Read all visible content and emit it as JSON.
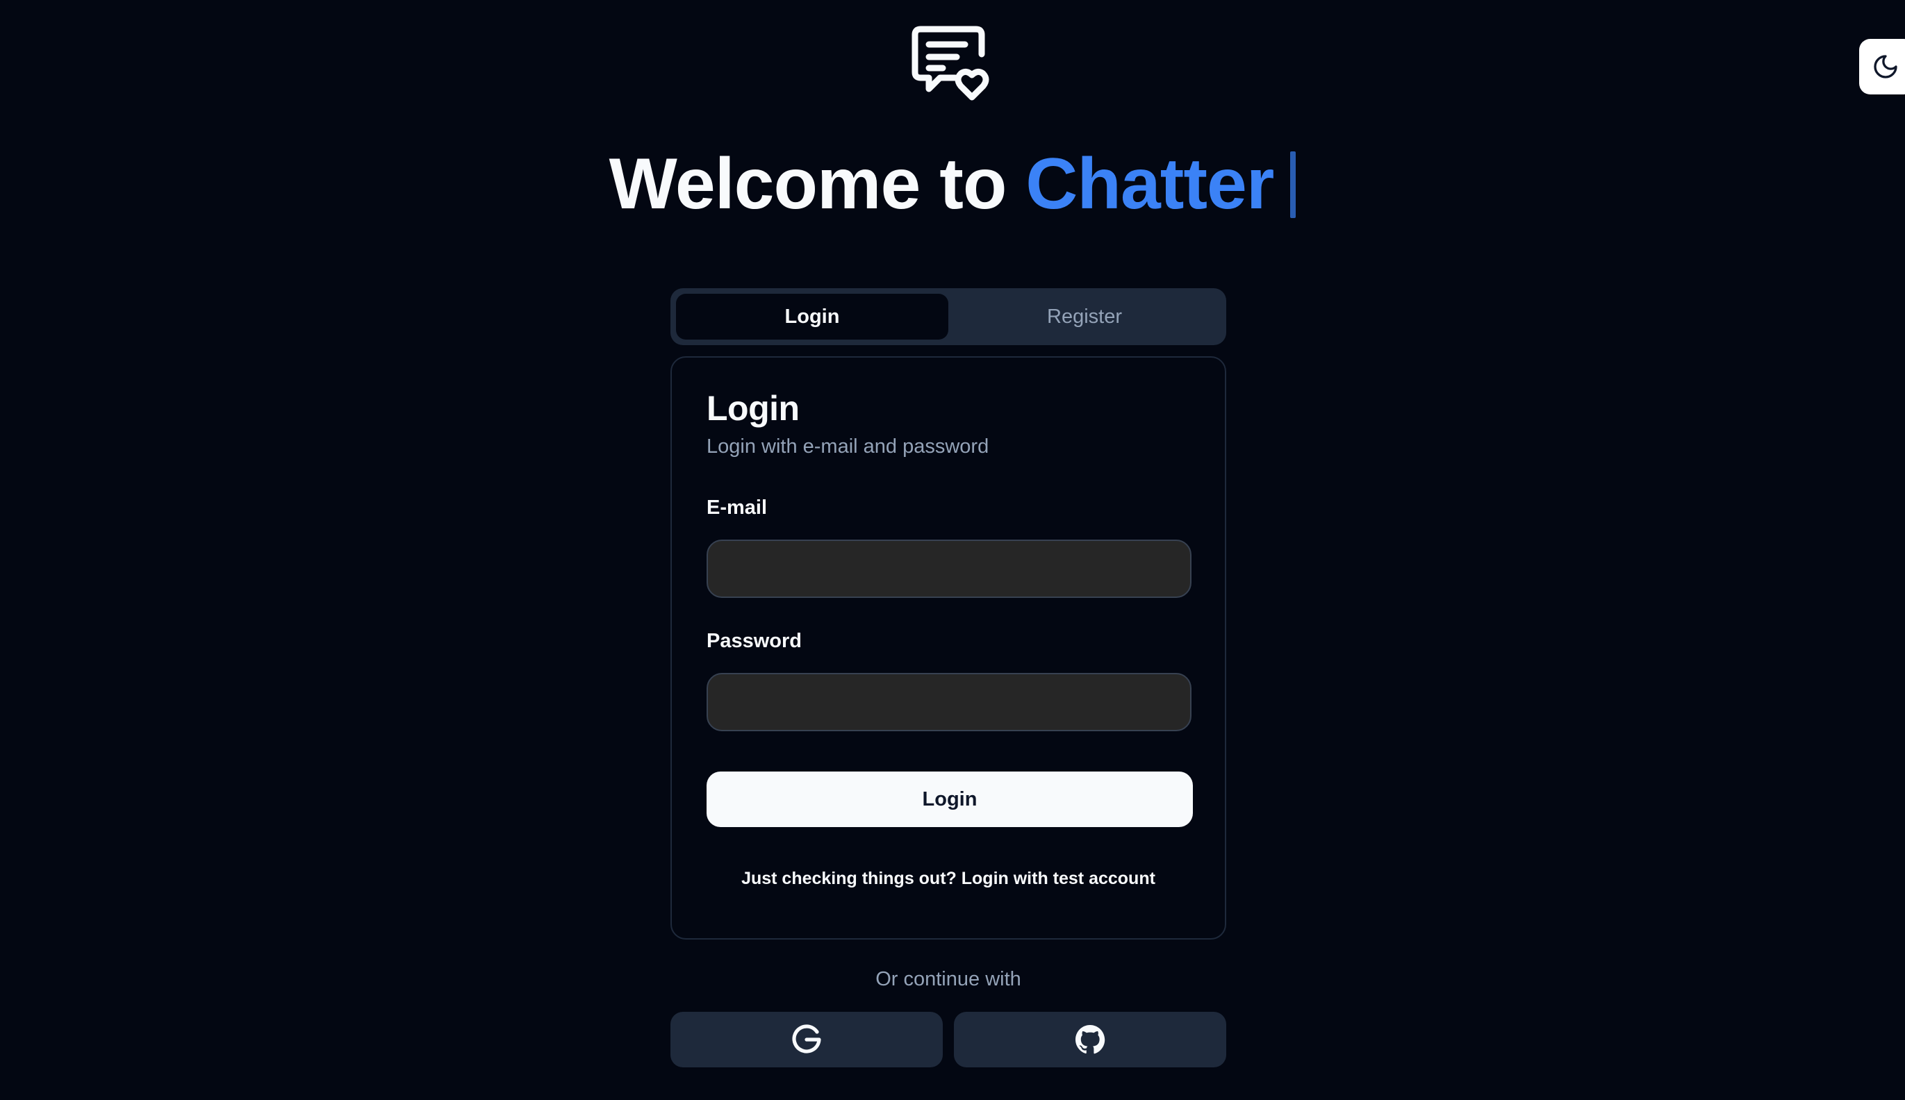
{
  "app": {
    "logo_icon": "message-heart-icon",
    "headline": {
      "prefix": "Welcome to ",
      "highlight": "Chatter"
    },
    "accent_color": "#3b82f6",
    "background_color": "#030712"
  },
  "theme_toggle": {
    "icon": "moon-icon"
  },
  "tabs": [
    {
      "label": "Login",
      "active": true
    },
    {
      "label": "Register",
      "active": false
    }
  ],
  "login_card": {
    "title": "Login",
    "subtitle": "Login with e-mail and password",
    "email": {
      "label": "E-mail",
      "value": "",
      "placeholder": ""
    },
    "password": {
      "label": "Password",
      "value": "",
      "placeholder": ""
    },
    "submit_label": "Login",
    "test_account_text": "Just checking things out? Login with test account"
  },
  "alt_login": {
    "divider_text": "Or continue with",
    "providers": [
      {
        "name": "google",
        "icon": "google-icon"
      },
      {
        "name": "github",
        "icon": "github-icon"
      }
    ]
  }
}
